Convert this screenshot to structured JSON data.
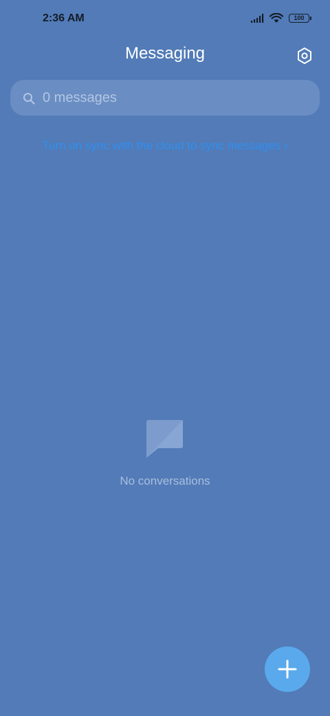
{
  "status_bar": {
    "time": "2:36 AM",
    "battery_level": "100",
    "icons": [
      "signal-icon",
      "wifi-icon",
      "battery-icon"
    ]
  },
  "header": {
    "title": "Messaging",
    "settings_icon": "settings-icon"
  },
  "search": {
    "placeholder": "0 messages",
    "icon": "search-icon"
  },
  "sync_prompt": {
    "text": "Turn on sync with the cloud to sync messages",
    "arrow": "›"
  },
  "empty_state": {
    "icon": "chat-bubble-icon",
    "text": "No conversations"
  },
  "fab": {
    "icon": "plus-icon"
  },
  "colors": {
    "background": "#527bb7",
    "search_background": "#6a8dc3",
    "link": "#2f8ff0",
    "fab": "#5aa9ec",
    "status_text": "#141c28"
  }
}
